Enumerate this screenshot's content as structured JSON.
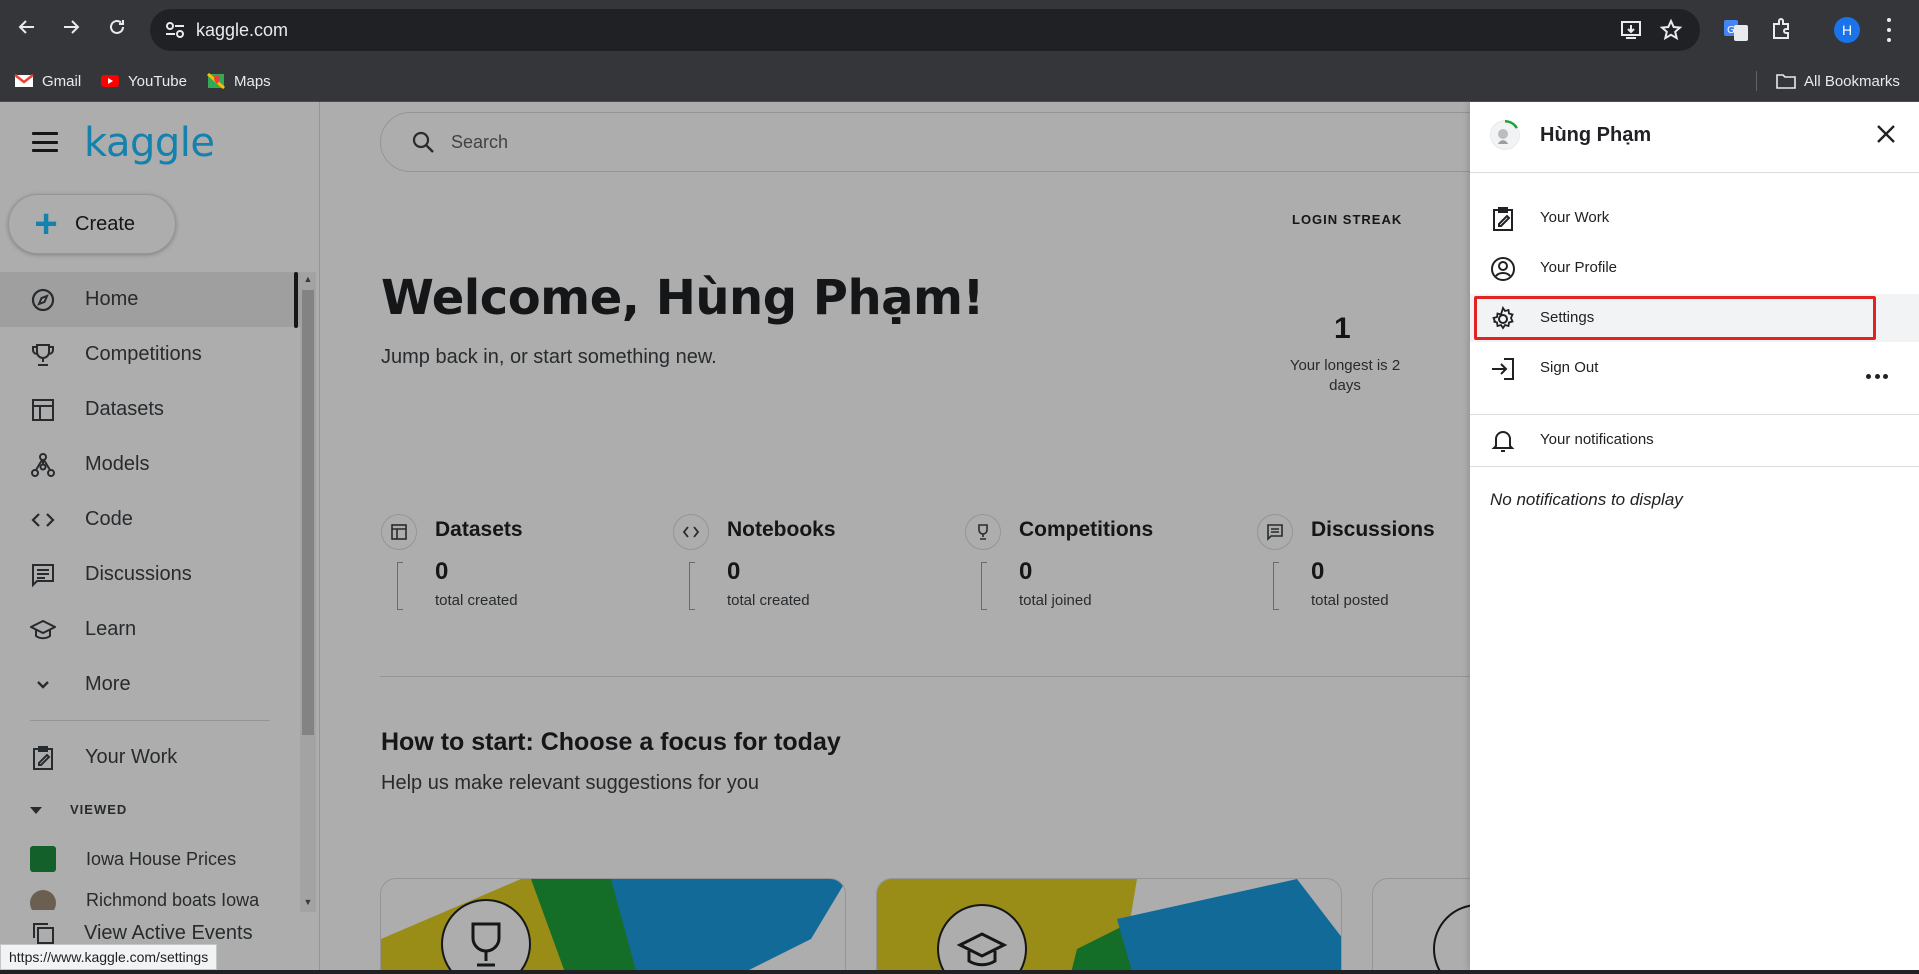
{
  "browser": {
    "url": "kaggle.com",
    "profile_initial": "H",
    "bookmarks": [
      "Gmail",
      "YouTube",
      "Maps"
    ],
    "all_bookmarks": "All Bookmarks",
    "status_url": "https://www.kaggle.com/settings"
  },
  "sidebar": {
    "logo": "kaggle",
    "create_label": "Create",
    "items": [
      {
        "label": "Home",
        "icon": "compass-icon"
      },
      {
        "label": "Competitions",
        "icon": "trophy-icon"
      },
      {
        "label": "Datasets",
        "icon": "table-icon"
      },
      {
        "label": "Models",
        "icon": "models-icon"
      },
      {
        "label": "Code",
        "icon": "code-icon"
      },
      {
        "label": "Discussions",
        "icon": "discussion-icon"
      },
      {
        "label": "Learn",
        "icon": "graduation-cap-icon"
      },
      {
        "label": "More",
        "icon": "chevron-down-icon"
      }
    ],
    "your_work": "Your Work",
    "viewed_label": "VIEWED",
    "viewed_items": [
      "Iowa House Prices",
      "Richmond boats Iowa"
    ],
    "active_events": "View Active Events"
  },
  "main": {
    "search_placeholder": "Search",
    "login_streak_label": "LOGIN STREAK",
    "streak_value": "1",
    "streak_longest": "Your longest is 2 days",
    "welcome": "Welcome, Hùng Phạm!",
    "subtitle": "Jump back in, or start something new.",
    "stats": [
      {
        "title": "Datasets",
        "value": "0",
        "caption": "total created"
      },
      {
        "title": "Notebooks",
        "value": "0",
        "caption": "total created"
      },
      {
        "title": "Competitions",
        "value": "0",
        "caption": "total joined"
      },
      {
        "title": "Discussions",
        "value": "0",
        "caption": "total posted"
      }
    ],
    "howto_title": "How to start: Choose a focus for today",
    "howto_sub": "Help us make relevant suggestions for you"
  },
  "panel": {
    "user_name": "Hùng Phạm",
    "items": [
      {
        "label": "Your Work",
        "icon": "clipboard-edit-icon"
      },
      {
        "label": "Your Profile",
        "icon": "profile-icon"
      },
      {
        "label": "Settings",
        "icon": "gear-icon"
      },
      {
        "label": "Sign Out",
        "icon": "sign-out-icon"
      }
    ],
    "notifications_label": "Your notifications",
    "no_notifications": "No notifications to display"
  },
  "colors": {
    "kaggle_blue": "#20beff",
    "highlight_red": "#e32222"
  }
}
